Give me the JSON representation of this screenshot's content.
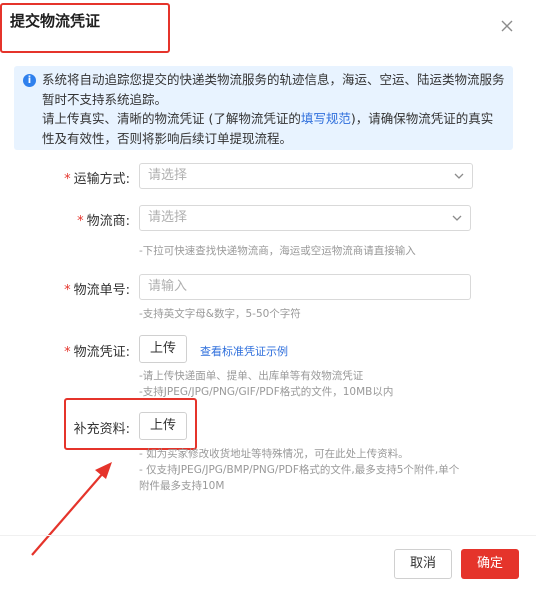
{
  "dialog": {
    "title": "提交物流凭证",
    "close_icon": "close-icon"
  },
  "notice": {
    "icon": "info-icon",
    "icon_glyph": "i",
    "line1": "系统将自动追踪您提交的快递类物流服务的轨迹信息，海运、空运、陆运类物流服务暂时不支持系统追踪。",
    "line2_prefix": "请上传真实、清晰的物流凭证 (了解物流凭证的",
    "line2_link": "填写规范",
    "line2_suffix": ")，请确保物流凭证的真实性及有效性，否则将影响后续订单提现流程。"
  },
  "form": {
    "transport": {
      "label": "运输方式:",
      "placeholder": "请选择",
      "required": "*"
    },
    "carrier": {
      "label": "物流商:",
      "placeholder": "请选择",
      "required": "*",
      "hint": "-下拉可快速查找快递物流商，海运或空运物流商请直接输入"
    },
    "tracking": {
      "label": "物流单号:",
      "placeholder": "请输入",
      "required": "*",
      "hint": "-支持英文字母&数字，5-50个字符"
    },
    "voucher": {
      "label": "物流凭证:",
      "required": "*",
      "upload_label": "上传",
      "example_link": "查看标准凭证示例",
      "hint1": "-请上传快递面单、提单、出库单等有效物流凭证",
      "hint2": "-支持JPEG/JPG/PNG/GIF/PDF格式的文件，10MB以内"
    },
    "supplement": {
      "label": "补充资料:",
      "upload_label": "上传",
      "hint1": "- 如为买家修改收货地址等特殊情况，可在此处上传资料。",
      "hint2": "- 仅支持JPEG/JPG/BMP/PNG/PDF格式的文件,最多支持5个附件,单个",
      "hint3": "附件最多支持10M"
    }
  },
  "footer": {
    "cancel_label": "取消",
    "ok_label": "确定"
  },
  "colors": {
    "accent_red": "#e5342b",
    "link_blue": "#2f6fdc",
    "notice_bg": "#e8f3ff"
  }
}
